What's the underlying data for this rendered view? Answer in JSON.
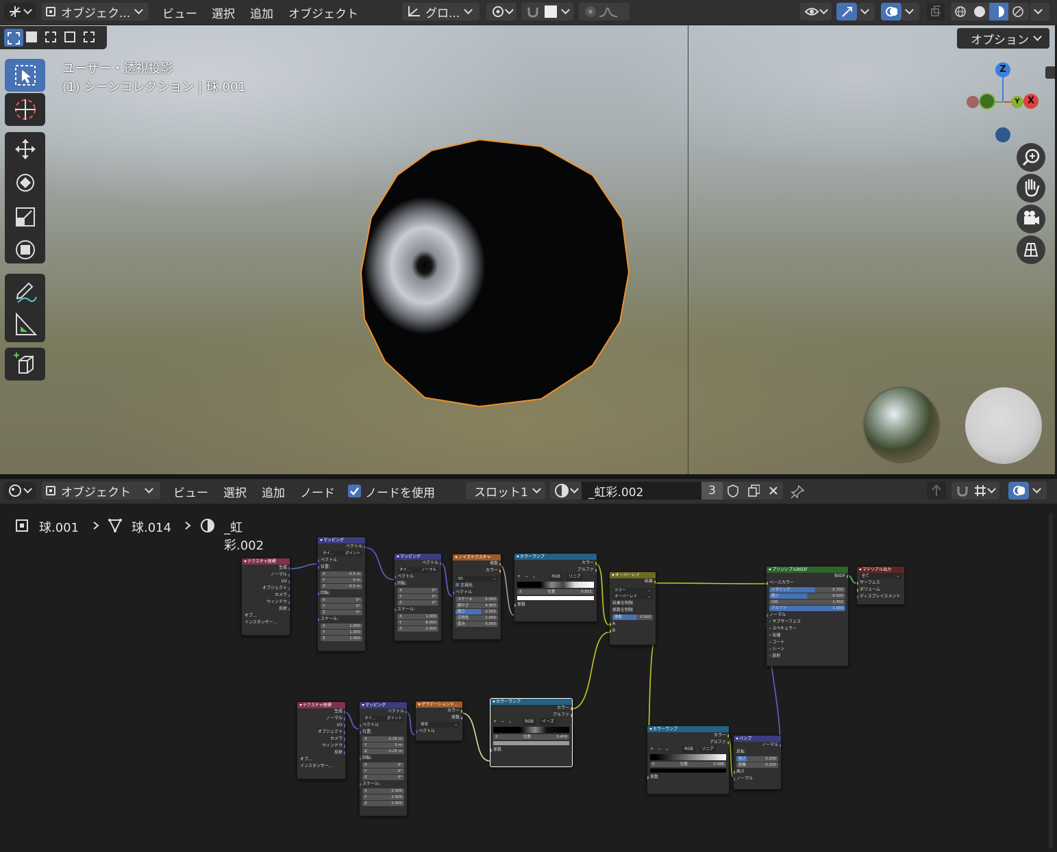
{
  "viewport": {
    "header": {
      "mode": "オブジェク...",
      "menus": [
        "ビュー",
        "選択",
        "追加",
        "オブジェクト"
      ],
      "transform_orientation": "グロ...",
      "options_label": "オプション"
    },
    "overlay_text": {
      "view_name": "ユーザー・透視投影",
      "collection": "(1) シーンコレクション | 球.001"
    },
    "gizmo": {
      "z": "Z",
      "x": "X",
      "y": "Y"
    }
  },
  "node_editor": {
    "header": {
      "mode": "オブジェクト",
      "menus": [
        "ビュー",
        "選択",
        "追加",
        "ノード"
      ],
      "use_nodes_label": "ノードを使用",
      "slot": "スロット1",
      "material": "_虹彩.002",
      "users": "3"
    },
    "breadcrumb": [
      "球.001",
      "球.014",
      "_虹彩.002"
    ],
    "nodes": {
      "texcoord1": {
        "title": "テクスチャ座標",
        "outputs": [
          "生成",
          "ノーマル",
          "UV",
          "オブジェクト",
          "カメラ",
          "ウィンドウ",
          "反射"
        ],
        "obj": "オブ...",
        "inst": "インスタンサー..."
      },
      "mapping1": {
        "title": "マッピング",
        "out": "ベクトル",
        "type_label": "タイ...",
        "type": "ポイント",
        "vec": "ベクトル",
        "loc": "位置:",
        "loc_vals": [
          "-0.5 m",
          "0 m",
          "-0.5 m"
        ],
        "rot": "回転:",
        "rot_vals": [
          "0°",
          "0°",
          "0°"
        ],
        "scale": "スケール:",
        "scale_vals": [
          "1.000",
          "1.000",
          "1.000"
        ]
      },
      "mapping2": {
        "title": "マッピング",
        "out": "ベクトル",
        "type_label": "タイ...",
        "type": "ノーマル",
        "vec": "ベクトル",
        "rot": "回転:",
        "rot_vals": [
          "0°",
          "0°",
          "0°"
        ],
        "scale": "スケール:",
        "scale_vals": [
          "1.000",
          "8.000",
          "1.000"
        ]
      },
      "noise": {
        "title": "ノイズテクスチャ",
        "outs": [
          "係数",
          "カラー"
        ],
        "dim": "3D",
        "normalize": "正規化",
        "vec": "ベクトル",
        "fields": [
          [
            "スケール",
            "5.000"
          ],
          [
            "細かさ",
            "4.900"
          ],
          [
            "粗さ",
            "0.500"
          ],
          [
            "空隙性",
            "2.000"
          ],
          [
            "歪み",
            "0.000"
          ]
        ]
      },
      "ramp1": {
        "title": "カラーランプ",
        "outs": [
          "カラー",
          "アルファ"
        ],
        "mode": "RGB",
        "interp": "リニア",
        "idx": "3",
        "pos_label": "位置",
        "pos": "0.831",
        "in": "係数"
      },
      "mix": {
        "title": "オーバーレイ",
        "out": "結果",
        "type": "カラー",
        "blend": "オーバーレイ",
        "clamp_res": "結果を制限",
        "clamp_fac": "係数を制限",
        "fac_label": "係数",
        "fac": "0.500",
        "a": "A",
        "b": "B"
      },
      "bsdf": {
        "title": "プリンシプルBSDF",
        "out": "BSDF",
        "base": "ベースカラー",
        "fields": [
          [
            "メタリック",
            "0.700"
          ],
          [
            "粗さ",
            "0.500"
          ],
          [
            "IOR",
            "1.450"
          ],
          [
            "アルファ",
            "1.000"
          ]
        ],
        "normal": "ノーマル",
        "sections": [
          "サブサーフェス",
          "スペキュラー",
          "伝播",
          "コート",
          "シーン",
          "放射"
        ]
      },
      "output": {
        "title": "マテリアル出力",
        "target": "全て",
        "ins": [
          "サーフェス",
          "ボリューム",
          "ディスプレイスメント"
        ]
      },
      "texcoord2": {
        "title": "テクスチャ座標",
        "outputs": [
          "生成",
          "ノーマル",
          "UV",
          "オブジェクト",
          "カメラ",
          "ウィンドウ",
          "反射"
        ],
        "obj": "オブ...",
        "inst": "インスタンサー..."
      },
      "mapping3": {
        "title": "マッピング",
        "out": "ベクトル",
        "type_label": "タイ...",
        "type": "ポイント",
        "vec": "ベクトル",
        "loc": "位置:",
        "loc_vals": [
          "-1.25 m",
          "0 m",
          "-1.25 m"
        ],
        "rot": "回転:",
        "rot_vals": [
          "0°",
          "0°",
          "0°"
        ],
        "scale": "スケール:",
        "scale_vals": [
          "2.500",
          "2.500",
          "2.500"
        ]
      },
      "gradient": {
        "title": "グラデーションテ...",
        "outs": [
          "カラー",
          "係数"
        ],
        "type": "球状",
        "vec": "ベクトル"
      },
      "ramp2": {
        "title": "カラーランプ",
        "outs": [
          "カラー",
          "アルファ"
        ],
        "mode": "RGB",
        "interp": "イーズ",
        "idx": "2",
        "pos_label": "位置",
        "pos": "0.459",
        "in": "係数"
      },
      "ramp3": {
        "title": "カラーランプ",
        "outs": [
          "カラー",
          "アルファ"
        ],
        "mode": "RGB",
        "interp": "リニア",
        "idx": "0",
        "pos_label": "位置",
        "pos": "0.088",
        "in": "係数"
      },
      "bump": {
        "title": "バンプ",
        "out": "ノーマル",
        "invert": "反転",
        "fields": [
          [
            "強さ",
            "0.200"
          ],
          [
            "距離",
            "0.100"
          ]
        ],
        "ins": [
          "高さ",
          "ノーマル"
        ]
      }
    }
  }
}
